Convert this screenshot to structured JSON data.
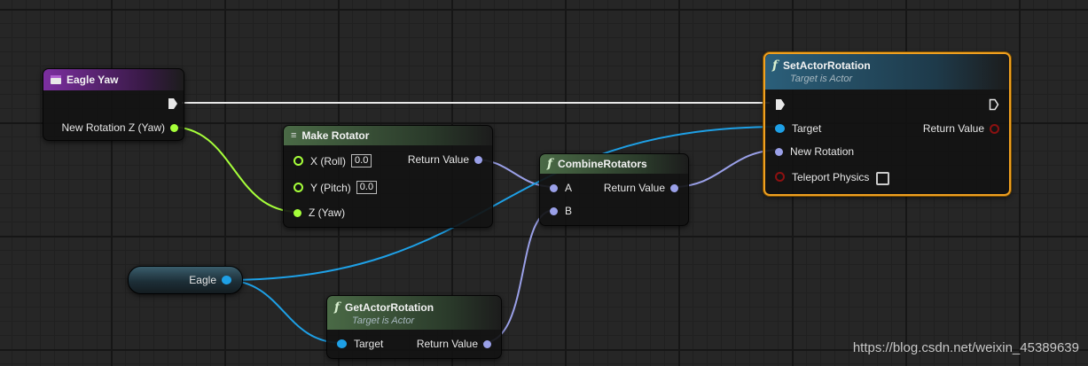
{
  "colors": {
    "exec": "#e8e8e8",
    "rotator": "#9aa0e8",
    "float": "#a6ff3a",
    "object": "#1ea0e6",
    "boolean": "#8c1111",
    "selected": "#f0a020"
  },
  "nodes": {
    "eagle_yaw": {
      "title": "Eagle Yaw",
      "icon": "event-icon",
      "out_label": "New Rotation Z (Yaw)"
    },
    "make_rotator": {
      "title": "Make Rotator",
      "icon": "make-struct-icon",
      "x_label": "X (Roll)",
      "x_value": "0.0",
      "y_label": "Y (Pitch)",
      "y_value": "0.0",
      "z_label": "Z (Yaw)",
      "return_label": "Return Value"
    },
    "combine": {
      "title": "CombineRotators",
      "icon": "function-icon",
      "a_label": "A",
      "b_label": "B",
      "return_label": "Return Value"
    },
    "set_rotation": {
      "title": "SetActorRotation",
      "subtitle": "Target is Actor",
      "icon": "function-icon",
      "target_label": "Target",
      "new_rotation_label": "New Rotation",
      "teleport_label": "Teleport Physics",
      "return_label": "Return Value"
    },
    "get_rotation": {
      "title": "GetActorRotation",
      "subtitle": "Target is Actor",
      "icon": "function-icon",
      "target_label": "Target",
      "return_label": "Return Value"
    },
    "eagle_var": {
      "label": "Eagle"
    }
  },
  "watermark": "https://blog.csdn.net/weixin_45389639"
}
